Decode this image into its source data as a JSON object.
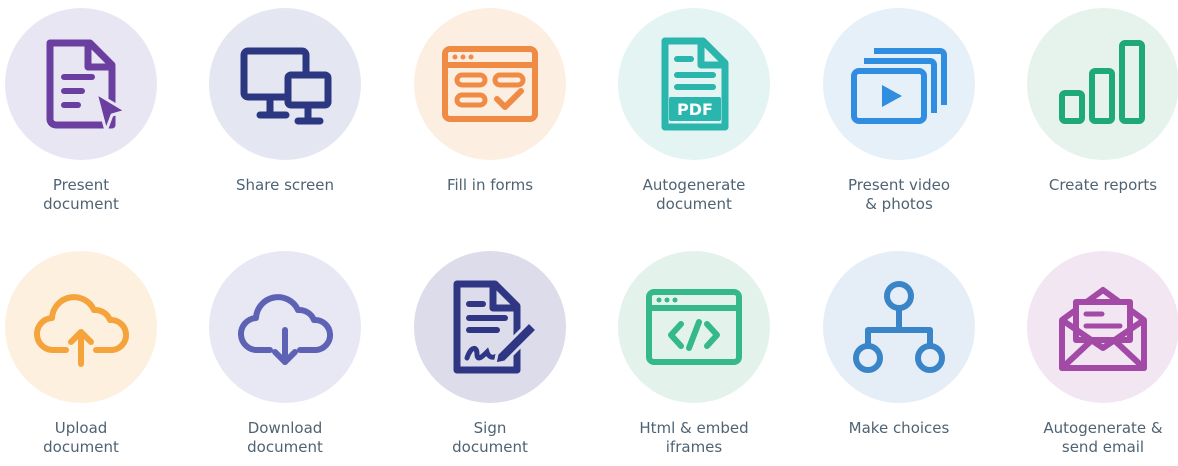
{
  "features": [
    {
      "label": "Present\ndocument",
      "icon": "present-document-icon",
      "bg": "#e9e6f3",
      "color": "#6b3fa0"
    },
    {
      "label": "Share screen",
      "icon": "share-screen-icon",
      "bg": "#e4e6f1",
      "color": "#2c3782"
    },
    {
      "label": "Fill in forms",
      "icon": "fill-in-forms-icon",
      "bg": "#fdeee2",
      "color": "#f08b45"
    },
    {
      "label": "Autogenerate\ndocument",
      "icon": "pdf-document-icon",
      "bg": "#e4f4f3",
      "color": "#2ab5ad"
    },
    {
      "label": "Present video\n& photos",
      "icon": "video-photos-icon",
      "bg": "#e6f0f9",
      "color": "#2f8ee0"
    },
    {
      "label": "Create reports",
      "icon": "bar-chart-icon",
      "bg": "#e6f3ec",
      "color": "#1fa97a"
    },
    {
      "label": "Upload\ndocument",
      "icon": "cloud-upload-icon",
      "bg": "#fdf0df",
      "color": "#f4a43b"
    },
    {
      "label": "Download\ndocument",
      "icon": "cloud-download-icon",
      "bg": "#e7e8f4",
      "color": "#5d62b5"
    },
    {
      "label": "Sign\ndocument",
      "icon": "sign-document-icon",
      "bg": "#dcdcea",
      "color": "#2f3785"
    },
    {
      "label": "Html & embed\niframes",
      "icon": "html-code-icon",
      "bg": "#e3f3ec",
      "color": "#35b88c"
    },
    {
      "label": "Make choices",
      "icon": "decision-tree-icon",
      "bg": "#e5eef7",
      "color": "#3a85c8"
    },
    {
      "label": "Autogenerate &\nsend email",
      "icon": "email-open-icon",
      "bg": "#f1e6f2",
      "color": "#a24aa6"
    }
  ]
}
